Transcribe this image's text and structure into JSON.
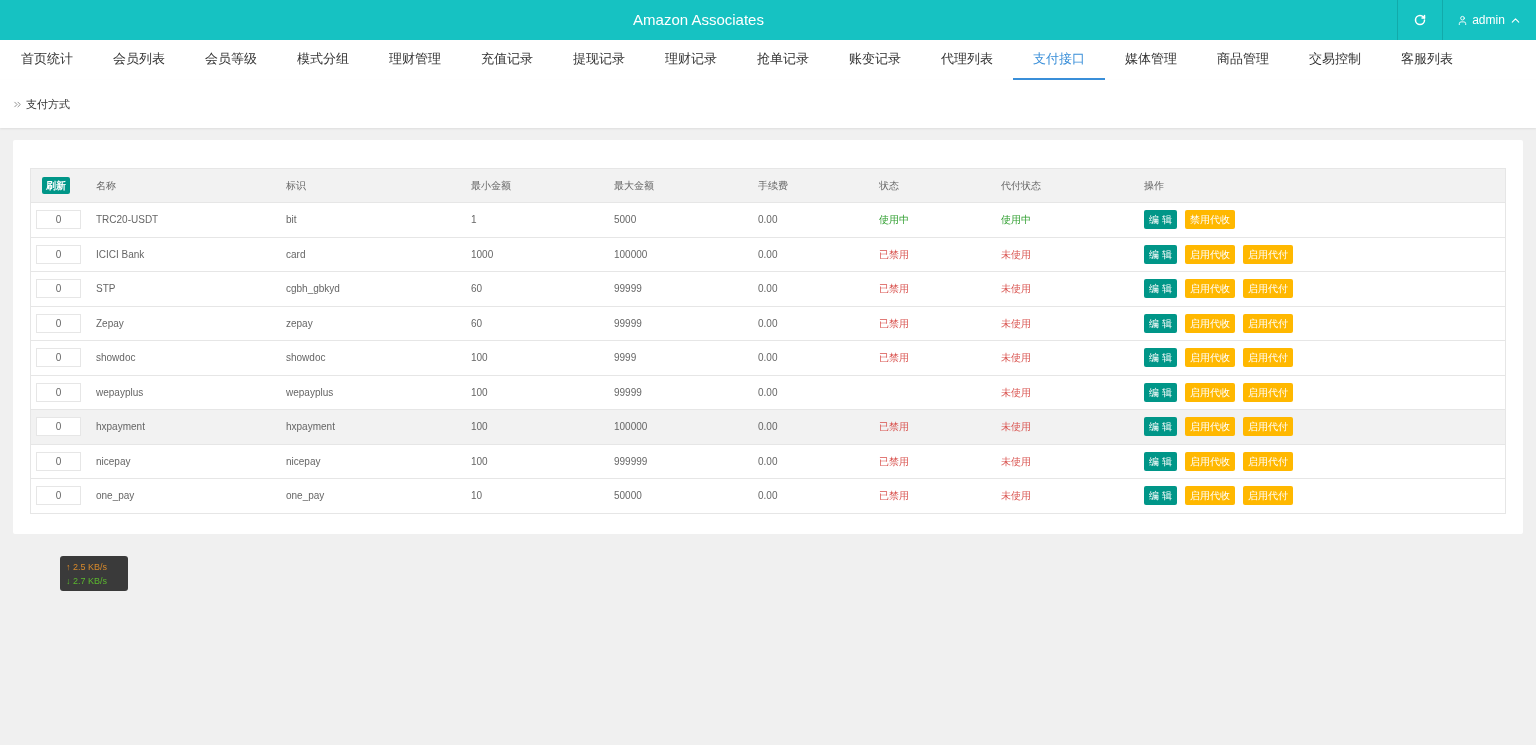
{
  "header": {
    "title": "Amazon Associates",
    "user": "admin"
  },
  "nav": [
    {
      "label": "首页统计",
      "selected": false
    },
    {
      "label": "会员列表",
      "selected": false
    },
    {
      "label": "会员等级",
      "selected": false
    },
    {
      "label": "模式分组",
      "selected": false
    },
    {
      "label": "理财管理",
      "selected": false
    },
    {
      "label": "充值记录",
      "selected": false
    },
    {
      "label": "提现记录",
      "selected": false
    },
    {
      "label": "理财记录",
      "selected": false
    },
    {
      "label": "抢单记录",
      "selected": false
    },
    {
      "label": "账变记录",
      "selected": false
    },
    {
      "label": "代理列表",
      "selected": false
    },
    {
      "label": "支付接口",
      "selected": true
    },
    {
      "label": "媒体管理",
      "selected": false
    },
    {
      "label": "商品管理",
      "selected": false
    },
    {
      "label": "交易控制",
      "selected": false
    },
    {
      "label": "客服列表",
      "selected": false
    }
  ],
  "breadcrumb": "支付方式",
  "table": {
    "refresh_button": "刷新",
    "columns": [
      "名称",
      "标识",
      "最小金额",
      "最大金额",
      "手续费",
      "状态",
      "代付状态",
      "操作"
    ],
    "rows": [
      {
        "sort": "0",
        "name": "TRC20-USDT",
        "ident": "bit",
        "min": "1",
        "max": "5000",
        "fee": "0.00",
        "status": {
          "text": "使用中",
          "active": true
        },
        "pay_status": {
          "text": "使用中",
          "active": true
        },
        "highlighted": false,
        "actions": [
          {
            "label": "编 辑",
            "kind": "edit"
          },
          {
            "label": "禁用代收",
            "kind": "toggle"
          }
        ]
      },
      {
        "sort": "0",
        "name": "ICICI Bank",
        "ident": "card",
        "min": "1000",
        "max": "100000",
        "fee": "0.00",
        "status": {
          "text": "已禁用",
          "active": false
        },
        "pay_status": {
          "text": "未使用",
          "active": false
        },
        "highlighted": false,
        "actions": [
          {
            "label": "编 辑",
            "kind": "edit"
          },
          {
            "label": "启用代收",
            "kind": "toggle"
          },
          {
            "label": "启用代付",
            "kind": "toggle"
          }
        ]
      },
      {
        "sort": "0",
        "name": "STP",
        "ident": "cgbh_gbkyd",
        "min": "60",
        "max": "99999",
        "fee": "0.00",
        "status": {
          "text": "已禁用",
          "active": false
        },
        "pay_status": {
          "text": "未使用",
          "active": false
        },
        "highlighted": false,
        "actions": [
          {
            "label": "编 辑",
            "kind": "edit"
          },
          {
            "label": "启用代收",
            "kind": "toggle"
          },
          {
            "label": "启用代付",
            "kind": "toggle"
          }
        ]
      },
      {
        "sort": "0",
        "name": "Zepay",
        "ident": "zepay",
        "min": "60",
        "max": "99999",
        "fee": "0.00",
        "status": {
          "text": "已禁用",
          "active": false
        },
        "pay_status": {
          "text": "未使用",
          "active": false
        },
        "highlighted": false,
        "actions": [
          {
            "label": "编 辑",
            "kind": "edit"
          },
          {
            "label": "启用代收",
            "kind": "toggle"
          },
          {
            "label": "启用代付",
            "kind": "toggle"
          }
        ]
      },
      {
        "sort": "0",
        "name": "showdoc",
        "ident": "showdoc",
        "min": "100",
        "max": "9999",
        "fee": "0.00",
        "status": {
          "text": "已禁用",
          "active": false
        },
        "pay_status": {
          "text": "未使用",
          "active": false
        },
        "highlighted": false,
        "actions": [
          {
            "label": "编 辑",
            "kind": "edit"
          },
          {
            "label": "启用代收",
            "kind": "toggle"
          },
          {
            "label": "启用代付",
            "kind": "toggle"
          }
        ]
      },
      {
        "sort": "0",
        "name": "wepayplus",
        "ident": "wepayplus",
        "min": "100",
        "max": "99999",
        "fee": "0.00",
        "pay_status": {
          "text": "未使用",
          "active": false
        },
        "highlighted": false,
        "actions": [
          {
            "label": "编 辑",
            "kind": "edit"
          },
          {
            "label": "启用代收",
            "kind": "toggle"
          },
          {
            "label": "启用代付",
            "kind": "toggle"
          }
        ]
      },
      {
        "sort": "0",
        "name": "hxpayment",
        "ident": "hxpayment",
        "min": "100",
        "max": "100000",
        "fee": "0.00",
        "status": {
          "text": "已禁用",
          "active": false
        },
        "pay_status": {
          "text": "未使用",
          "active": false
        },
        "highlighted": true,
        "actions": [
          {
            "label": "编 辑",
            "kind": "edit"
          },
          {
            "label": "启用代收",
            "kind": "toggle"
          },
          {
            "label": "启用代付",
            "kind": "toggle"
          }
        ]
      },
      {
        "sort": "0",
        "name": "nicepay",
        "ident": "nicepay",
        "min": "100",
        "max": "999999",
        "fee": "0.00",
        "status": {
          "text": "已禁用",
          "active": false
        },
        "pay_status": {
          "text": "未使用",
          "active": false
        },
        "highlighted": false,
        "actions": [
          {
            "label": "编 辑",
            "kind": "edit"
          },
          {
            "label": "启用代收",
            "kind": "toggle"
          },
          {
            "label": "启用代付",
            "kind": "toggle"
          }
        ]
      },
      {
        "sort": "0",
        "name": "one_pay",
        "ident": "one_pay",
        "min": "10",
        "max": "50000",
        "fee": "0.00",
        "status": {
          "text": "已禁用",
          "active": false
        },
        "pay_status": {
          "text": "未使用",
          "active": false
        },
        "highlighted": false,
        "actions": [
          {
            "label": "编 辑",
            "kind": "edit"
          },
          {
            "label": "启用代收",
            "kind": "toggle"
          },
          {
            "label": "启用代付",
            "kind": "toggle"
          }
        ]
      }
    ]
  },
  "speed": {
    "up": "↑ 2.5 KB/s",
    "down": "↓ 2.7 KB/s"
  }
}
